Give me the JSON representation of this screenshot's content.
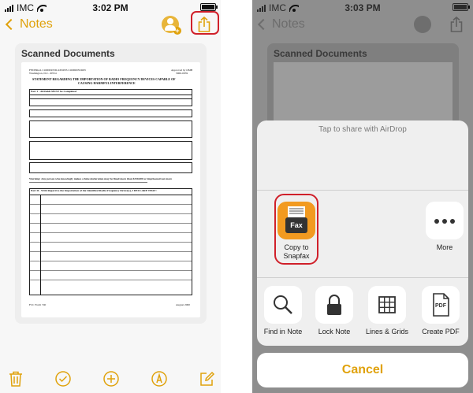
{
  "left": {
    "status": {
      "carrier": "IMC",
      "time": "3:02 PM"
    },
    "nav": {
      "back_label": "Notes"
    },
    "card": {
      "title": "Scanned Documents"
    },
    "document": {
      "header_left": "FEDERAL COMMUNICATIONS COMMISSION",
      "header_left2": "Washington, D.C. 20554",
      "header_right": "Approved by OMB",
      "header_right2": "3060-0059",
      "title1": "STATEMENT REGARDING THE IMPORTATION OF RADIO FREQUENCY DEVICES CAPABLE OF",
      "title2": "CAUSING HARMFUL INTERFERENCE",
      "part1": "Part 1 - All fields MUST be Completed",
      "part2": "Part II - With Regard to the Importation of the Identified Radio Frequency Device(s), I DECLARE THAT :",
      "warning": "Warning: Any person who knowingly makes a false declaration may be fined more than $250,000 or imprisoned not more",
      "footer_left": "FCC Form 740",
      "footer_right": "August 2000"
    }
  },
  "right": {
    "status": {
      "carrier": "IMC",
      "time": "3:03 PM"
    },
    "nav": {
      "back_label": "Notes"
    },
    "card": {
      "title": "Scanned Documents"
    },
    "sheet": {
      "airdrop_hint": "Tap to share with AirDrop",
      "apps": [
        {
          "label": "Copy to\nSnapfax",
          "icon": "snapfax-icon"
        },
        {
          "label": "More",
          "icon": "more-icon"
        }
      ],
      "fax_label": "Fax",
      "actions": [
        {
          "label": "Find in Note",
          "icon": "magnifier-icon"
        },
        {
          "label": "Lock Note",
          "icon": "lock-icon"
        },
        {
          "label": "Lines & Grids",
          "icon": "grid-icon"
        },
        {
          "label": "Create PDF",
          "icon": "pdf-icon"
        }
      ],
      "pdf_label": "PDF",
      "cancel_label": "Cancel"
    }
  },
  "colors": {
    "accent": "#e0a20c",
    "highlight": "#d0202a",
    "snapfax": "#f29a20"
  }
}
